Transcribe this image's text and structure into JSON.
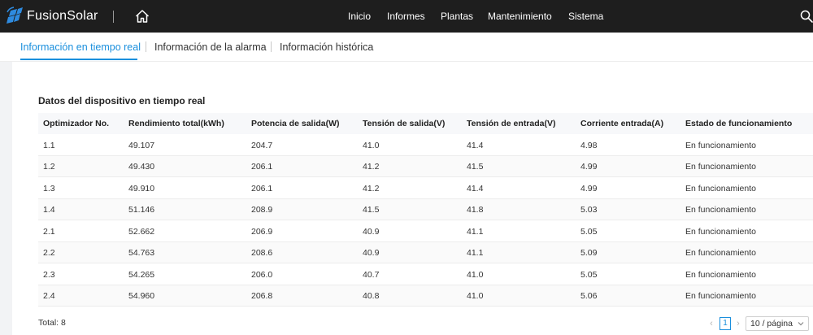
{
  "app": {
    "brand": "FusionSolar",
    "colors": {
      "topbar": "#1e1e1e",
      "accent": "#1a8fdd",
      "logo_blue": "#2e8be0"
    }
  },
  "nav": [
    {
      "label": "Inicio"
    },
    {
      "label": "Informes"
    },
    {
      "label": "Plantas"
    },
    {
      "label": "Mantenimiento"
    },
    {
      "label": "Sistema"
    }
  ],
  "icons": {
    "logo": "fusionsolar-logo-icon",
    "home": "home-icon",
    "search": "search-icon",
    "chevron": "chevron-down-icon"
  },
  "tabs": [
    {
      "label": "Información en tiempo real",
      "active": true
    },
    {
      "label": "Información de la alarma",
      "active": false
    },
    {
      "label": "Información histórica",
      "active": false
    }
  ],
  "section": {
    "title": "Datos del dispositivo en tiempo real"
  },
  "table": {
    "columns": [
      "Optimizador No.",
      "Rendimiento total(kWh)",
      "Potencia de salida(W)",
      "Tensión de salida(V)",
      "Tensión de entrada(V)",
      "Corriente entrada(A)",
      "Estado de funcionamiento"
    ],
    "rows": [
      [
        "1.1",
        "49.107",
        "204.7",
        "41.0",
        "41.4",
        "4.98",
        "En funcionamiento"
      ],
      [
        "1.2",
        "49.430",
        "206.1",
        "41.2",
        "41.5",
        "4.99",
        "En funcionamiento"
      ],
      [
        "1.3",
        "49.910",
        "206.1",
        "41.2",
        "41.4",
        "4.99",
        "En funcionamiento"
      ],
      [
        "1.4",
        "51.146",
        "208.9",
        "41.5",
        "41.8",
        "5.03",
        "En funcionamiento"
      ],
      [
        "2.1",
        "52.662",
        "206.9",
        "40.9",
        "41.1",
        "5.05",
        "En funcionamiento"
      ],
      [
        "2.2",
        "54.763",
        "208.6",
        "40.9",
        "41.1",
        "5.09",
        "En funcionamiento"
      ],
      [
        "2.3",
        "54.265",
        "206.0",
        "40.7",
        "41.0",
        "5.05",
        "En funcionamiento"
      ],
      [
        "2.4",
        "54.960",
        "206.8",
        "40.8",
        "41.0",
        "5.06",
        "En funcionamiento"
      ]
    ]
  },
  "footer": {
    "total_label": "Total: 8",
    "current_page": "1",
    "page_size_label": "10 / página"
  }
}
